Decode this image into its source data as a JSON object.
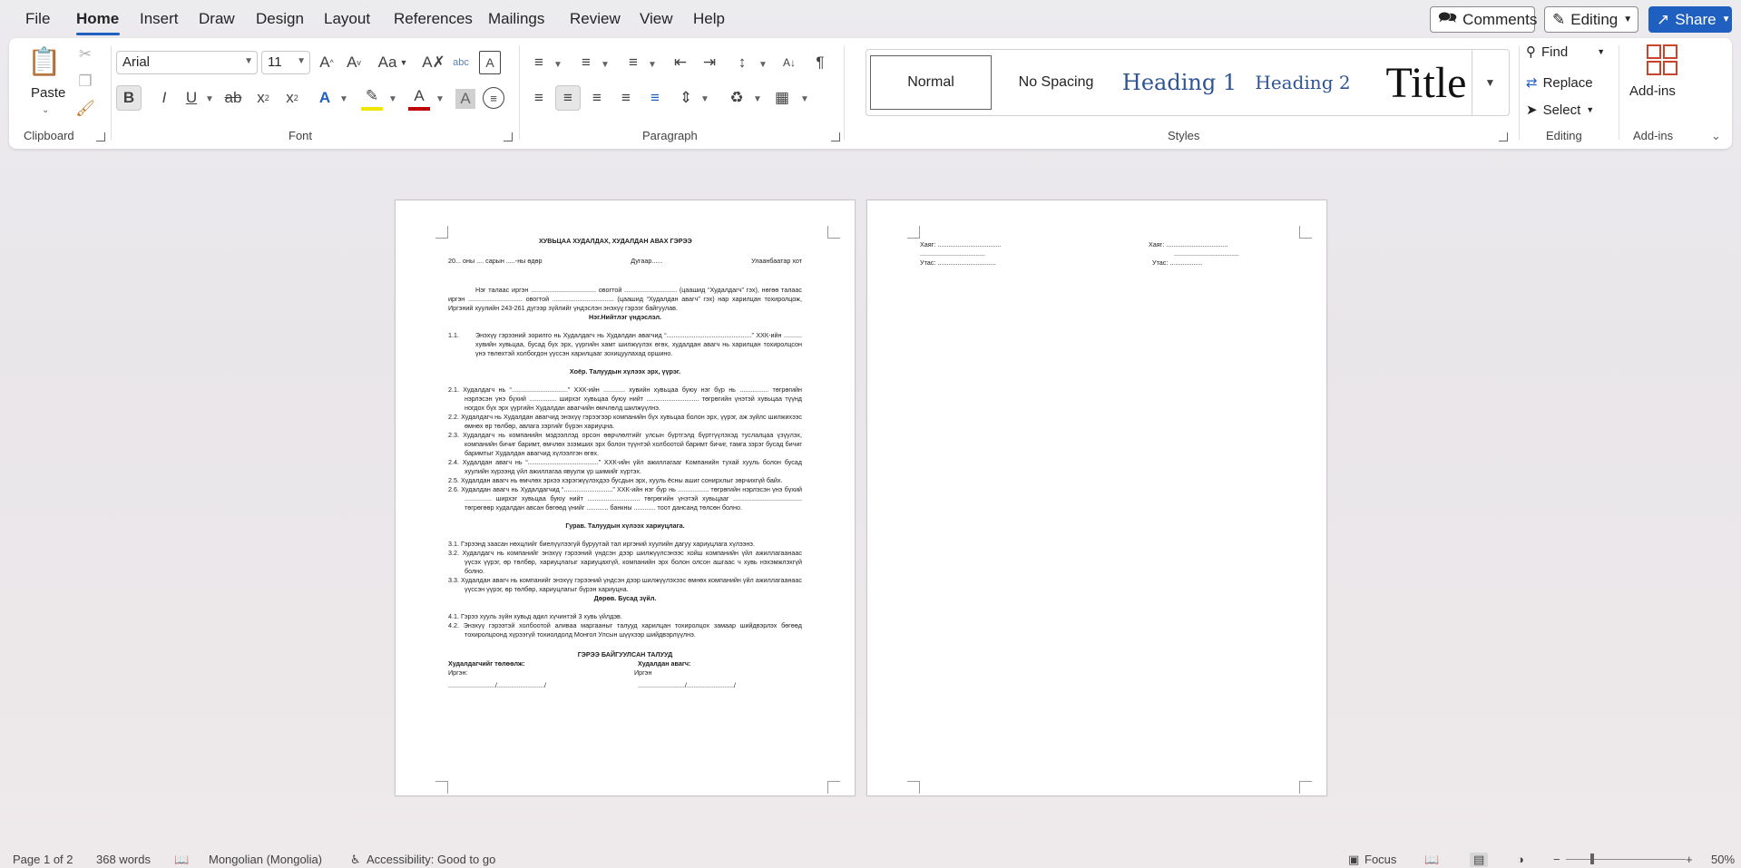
{
  "menu": {
    "items": [
      "File",
      "Home",
      "Insert",
      "Draw",
      "Design",
      "Layout",
      "References",
      "Mailings",
      "Review",
      "View",
      "Help"
    ],
    "active": "Home",
    "comments_label": "Comments",
    "editing_label": "Editing",
    "share_label": "Share"
  },
  "ribbon": {
    "clipboard": {
      "paste_label": "Paste",
      "group_label": "Clipboard"
    },
    "font": {
      "font_name": "Arial",
      "font_size": "11",
      "group_label": "Font",
      "change_case": "Aa"
    },
    "paragraph": {
      "group_label": "Paragraph"
    },
    "styles": {
      "group_label": "Styles",
      "items": [
        "Normal",
        "No Spacing",
        "Heading 1",
        "Heading 2",
        "Title"
      ]
    },
    "editing": {
      "find_label": "Find",
      "replace_label": "Replace",
      "select_label": "Select",
      "group_label": "Editing"
    },
    "addins": {
      "label": "Add-ins",
      "group_label": "Add-ins"
    }
  },
  "document": {
    "page1": {
      "title": "ХУВЬЦАА ХУДАЛДАХ, ХУДАЛДАН АВАХ ГЭРЭЭ",
      "date_line": "20... оны .... сарын .....-ны өдөр",
      "number_line": "Дугаар......",
      "city_line": "Улаанбаатар хот",
      "intro": "Нэг талаас иргэн .................................... овогтой ............................. (цаашид “Худалдагч” гэх), нөгөө талаас иргэн .............................. овогтой .................................. (цаашид “Худалдан авагч” гэх) нар харилцан тохиролцож, Иргэний хуулийн 243-261 дүгээр зүйлийг үндэслэн энэхүү гэрээг байгуулав.",
      "section1_title": "Нэг.Нийтлэг үндэслэл.",
      "s1_1_num": "1.1.",
      "s1_1": "Энэхүү гэрээний зорилго нь Худалдагч нь Худалдан авагчид “...............................................” ХХК-ийн .......... хувийн хувьцаа, бусад бүх эрх, үүргийн хамт шилжүүлэх өгөх, худалдан авагч нь харилцан тохиролцсон үнэ төлөхтэй холбогдон үүссэн харилцааг зохицуулахад оршино.",
      "section2_title": "Хоёр. Талуудын хүлээх эрх, үүрэг.",
      "s2_1": "2.1. Худалдагч нь “...............................” ХХК-ийн ............ хувийн хувьцаа буюу нэг бүр нь ................ төгрөгийн нэрлэсэн үнэ бүхий ............... ширхэг хувьцаа буюу нийт ............................. төгрөгийн үнэтэй хувьцаа түүнд ногдох бүх эрх үүргийн Худалдан авагчийн өмчлөлд шилжүүлнэ.",
      "s2_2": "2.2. Худалдагч нь Худалдан авагчид энэхүү гэрээгээр компанийн бүх хувьцаа болон эрх, үүрэг, аж зүйлс шилжихээс өмнөх өр төлбөр, авлага зэргийг бүрэн хариуцна.",
      "s2_3": "2.3. Худалдагч нь компанийн мэдээллэд орсон өөрчлөлтийг улсын бүртгэлд бүртгүүлэхэд туслалцаа үзүүлэх, компанийн бичиг баримт, өмчлөх эзэмших эрх болон түүнтэй холбоотой баримт бичиг, тамга зэрэг бусад бичиг баримтыг Худалдан авагчид хүлээлгэн өгөх.",
      "s2_4": "2.4. Худалдан авагч нь “.......................................” ХХК-ийн үйл ажиллагааг Компанийн тухай хууль болон бусад хуулийн хүрээнд үйл ажиллагаа явуулж үр шимийг хүртэх.",
      "s2_5": "2.5. Худалдан авагч нь өмчлөх эрхээ хэрэгжүүлэхдээ бусдын эрх, хууль ёсны ашиг сонирхлыг зөрчихгүй байх.",
      "s2_6": "2.6. Худалдан авагч нь Худалдагчид “...........................” ХХК-ийн нэг бүр нь ................. төгрөгийн нэрлэсэн үнэ бүхий ............... ширхэг хувьцаа буюу нийт ............................. төгрөгийн үнэтэй хувьцааг ...................................... төгрөгөөр худалдан авсан бөгөөд үнийг ............ банкны ............ тоот дансанд төлсөн болно.",
      "section3_title": "Гурав. Талуудын хүлээх хариуцлага.",
      "s3_1": "3.1. Гэрээнд заасан нөхцлийг биелүүлээгүй буруутай тал иргэний хуулийн дагуу хариуцлага хүлээнэ.",
      "s3_2": "3.2. Худалдагч нь компанийг энэхүү гэрээний үндсэн дээр шилжүүлсэнээс хойш компанийн үйл ажиллагаанаас үүсэх үүрэг, өр төлбөр, хариуцлагыг хариуцахгүй, компанийн эрх болон олсон ашгаас ч хувь нэхэмжлэхгүй болно.",
      "s3_3": "3.3. Худалдан авагч нь компанийг энэхүү гэрээний үндсэн дээр шилжүүлэхээс өмнөх компанийн үйл ажиллагаанаас үүссэн үүрэг, өр төлбөр, хариуцлагыг бүрэн хариуцна.",
      "section4_title": "Дөрөв. Бусад зүйл.",
      "s4_1": "4.1. Гэрээ хууль зүйн хувьд адил хүчинтэй 3 хувь үйлдэв.",
      "s4_2": "4.2. Энэхүү гэрээтэй холбоотой аливаа маргааныг талууд харилцан тохиролцох замаар шийдвэрлэх бөгөөд тохиролцоонд хүрээгүй тохиолдолд Монгол Улсын шүүхээр шийдвэрлүүлнэ.",
      "signing_title": "ГЭРЭЭ БАЙГУУЛСАН ТАЛУУД",
      "seller_rep": "Худалдагчийг төлөөлж:",
      "buyer_rep": "Худалдан авагч:",
      "citizen_left": "Иргэн:",
      "citizen_right": "Иргэн",
      "sign_left": "........................../........................../",
      "sign_right": "........................../........................../"
    },
    "page2": {
      "addr_left": "Хаяг: ...................................",
      "addr_left_2": "....................................",
      "phone_left": "Утас: ................................",
      "addr_right": "Хаяг: ..................................",
      "addr_right_2": "....................................",
      "phone_right": "Утас: .................."
    }
  },
  "status": {
    "page": "Page 1 of 2",
    "words": "368 words",
    "language": "Mongolian (Mongolia)",
    "accessibility": "Accessibility: Good to go",
    "focus": "Focus",
    "zoom": "50%",
    "zoom_level": 0.5
  }
}
